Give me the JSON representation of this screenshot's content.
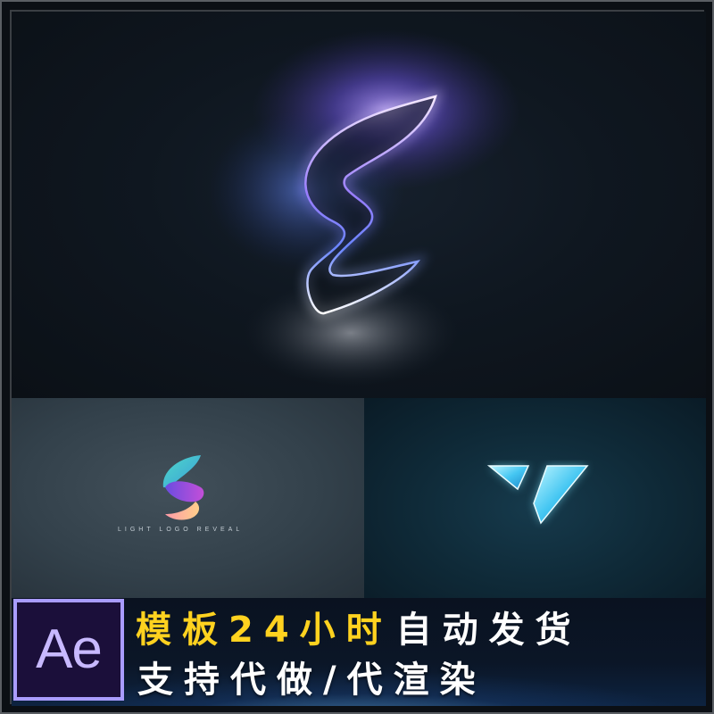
{
  "preview_top": {
    "logo_icon": "glowing-s-outline-icon"
  },
  "preview_bottom_left": {
    "logo_icon": "gradient-s-icon",
    "caption": "LIGHT LOGO REVEAL"
  },
  "preview_bottom_right": {
    "logo_icon": "cyan-v-logo-icon"
  },
  "banner": {
    "app_logo_text": "Ae",
    "line1_highlight": "模板24小时",
    "line1_rest": "自动发货",
    "line2": "支持代做/代渲染"
  },
  "colors": {
    "highlight": "#ffd21f",
    "ae_border": "#a99cff",
    "ae_bg": "#1b0f3a"
  }
}
